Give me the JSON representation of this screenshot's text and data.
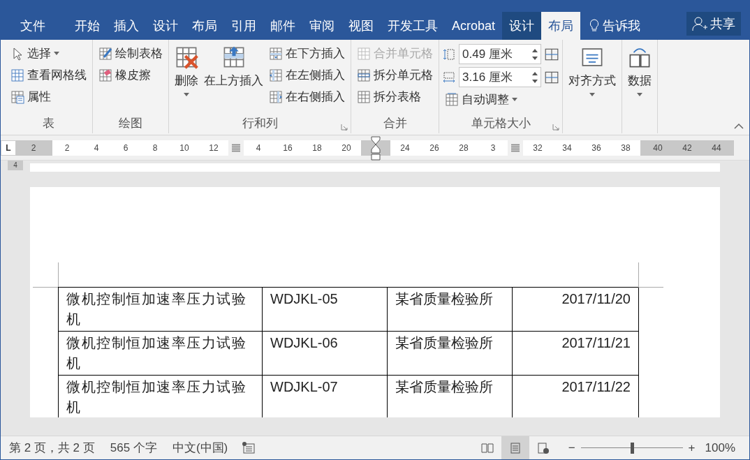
{
  "tabs": [
    {
      "label": "文件",
      "kind": "file",
      "selected": false
    },
    {
      "label": "开始",
      "kind": "normal",
      "selected": false
    },
    {
      "label": "插入",
      "kind": "normal",
      "selected": false
    },
    {
      "label": "设计",
      "kind": "normal",
      "selected": false
    },
    {
      "label": "布局",
      "kind": "normal",
      "selected": false
    },
    {
      "label": "引用",
      "kind": "normal",
      "selected": false
    },
    {
      "label": "邮件",
      "kind": "normal",
      "selected": false
    },
    {
      "label": "审阅",
      "kind": "normal",
      "selected": false
    },
    {
      "label": "视图",
      "kind": "normal",
      "selected": false
    },
    {
      "label": "开发工具",
      "kind": "normal",
      "selected": false
    },
    {
      "label": "Acrobat",
      "kind": "normal",
      "selected": false
    },
    {
      "label": "设计",
      "kind": "context",
      "selected": false
    },
    {
      "label": "布局",
      "kind": "context",
      "selected": true
    }
  ],
  "tell_me": "告诉我",
  "share": "共享",
  "groups": [
    {
      "label": "表",
      "launcher": false,
      "items": [
        {
          "kind": "small",
          "label": "选择",
          "caret": true,
          "disabled": false
        },
        {
          "kind": "small",
          "label": "查看网格线",
          "caret": false,
          "disabled": false
        },
        {
          "kind": "small",
          "label": "属性",
          "caret": false,
          "disabled": false
        }
      ]
    },
    {
      "label": "绘图",
      "launcher": false,
      "items": [
        {
          "kind": "small",
          "label": "绘制表格",
          "caret": false,
          "disabled": false
        },
        {
          "kind": "small",
          "label": "橡皮擦",
          "caret": false,
          "disabled": false
        }
      ]
    },
    {
      "label": "行和列",
      "launcher": true,
      "items": [
        {
          "kind": "large",
          "label": "删除",
          "caret": true,
          "disabled": false
        },
        {
          "kind": "large",
          "label": "在上方插入",
          "caret": false,
          "disabled": false
        },
        {
          "kind": "column",
          "items": [
            {
              "label": "在下方插入",
              "disabled": false
            },
            {
              "label": "在左侧插入",
              "disabled": false
            },
            {
              "label": "在右侧插入",
              "disabled": false
            }
          ]
        }
      ]
    },
    {
      "label": "合并",
      "launcher": false,
      "items": [
        {
          "kind": "small",
          "label": "合并单元格",
          "caret": false,
          "disabled": true
        },
        {
          "kind": "small",
          "label": "拆分单元格",
          "caret": false,
          "disabled": false
        },
        {
          "kind": "small",
          "label": "拆分表格",
          "caret": false,
          "disabled": false
        }
      ]
    },
    {
      "label": "单元格大小",
      "launcher": true,
      "items": [
        {
          "kind": "size",
          "value": "0.49 厘米"
        },
        {
          "kind": "size",
          "value": "3.16 厘米"
        },
        {
          "kind": "small",
          "label": "自动调整",
          "caret": true,
          "disabled": false
        }
      ]
    },
    {
      "launcher": false,
      "items": [
        {
          "kind": "large",
          "label": "对齐方式",
          "caret": true,
          "disabled": false
        }
      ]
    },
    {
      "launcher": false,
      "items": [
        {
          "kind": "large",
          "label": "数据",
          "caret": true,
          "disabled": false
        }
      ]
    }
  ],
  "ruler": {
    "tab_stop": "L",
    "vertical_label": "4",
    "segments": [
      {
        "kind": "margin",
        "labels": [
          "2"
        ]
      },
      {
        "kind": "text",
        "labels": [
          "2",
          "4",
          "6",
          "8",
          "10",
          "12"
        ]
      },
      {
        "kind": "marker"
      },
      {
        "kind": "text",
        "labels": [
          "4",
          "16",
          "18",
          "20"
        ]
      },
      {
        "kind": "indent"
      },
      {
        "kind": "text",
        "labels": [
          "24",
          "26",
          "28",
          "3"
        ]
      },
      {
        "kind": "marker"
      },
      {
        "kind": "text",
        "labels": [
          "32",
          "34",
          "36",
          "38"
        ]
      },
      {
        "kind": "margin",
        "labels": [
          "40",
          "42",
          "44"
        ]
      }
    ]
  },
  "table": {
    "rows": [
      [
        "微机控制恒加速率压力试验机",
        "WDJKL-05",
        "某省质量检验所",
        "2017/11/20"
      ],
      [
        "微机控制恒加速率压力试验机",
        "WDJKL-06",
        "某省质量检验所",
        "2017/11/21"
      ],
      [
        "微机控制恒加速率压力试验机",
        "WDJKL-07",
        "某省质量检验所",
        "2017/11/22"
      ]
    ]
  },
  "status_bar": {
    "page": "第 2 页，共 2 页",
    "words": "565 个字",
    "language": "中文(中国)",
    "views": [
      {
        "kind": "read",
        "selected": false
      },
      {
        "kind": "print",
        "selected": true
      },
      {
        "kind": "web",
        "selected": false
      }
    ],
    "zoom": {
      "level": 0.5,
      "label": "100%",
      "minus": "−",
      "plus": "+"
    }
  }
}
